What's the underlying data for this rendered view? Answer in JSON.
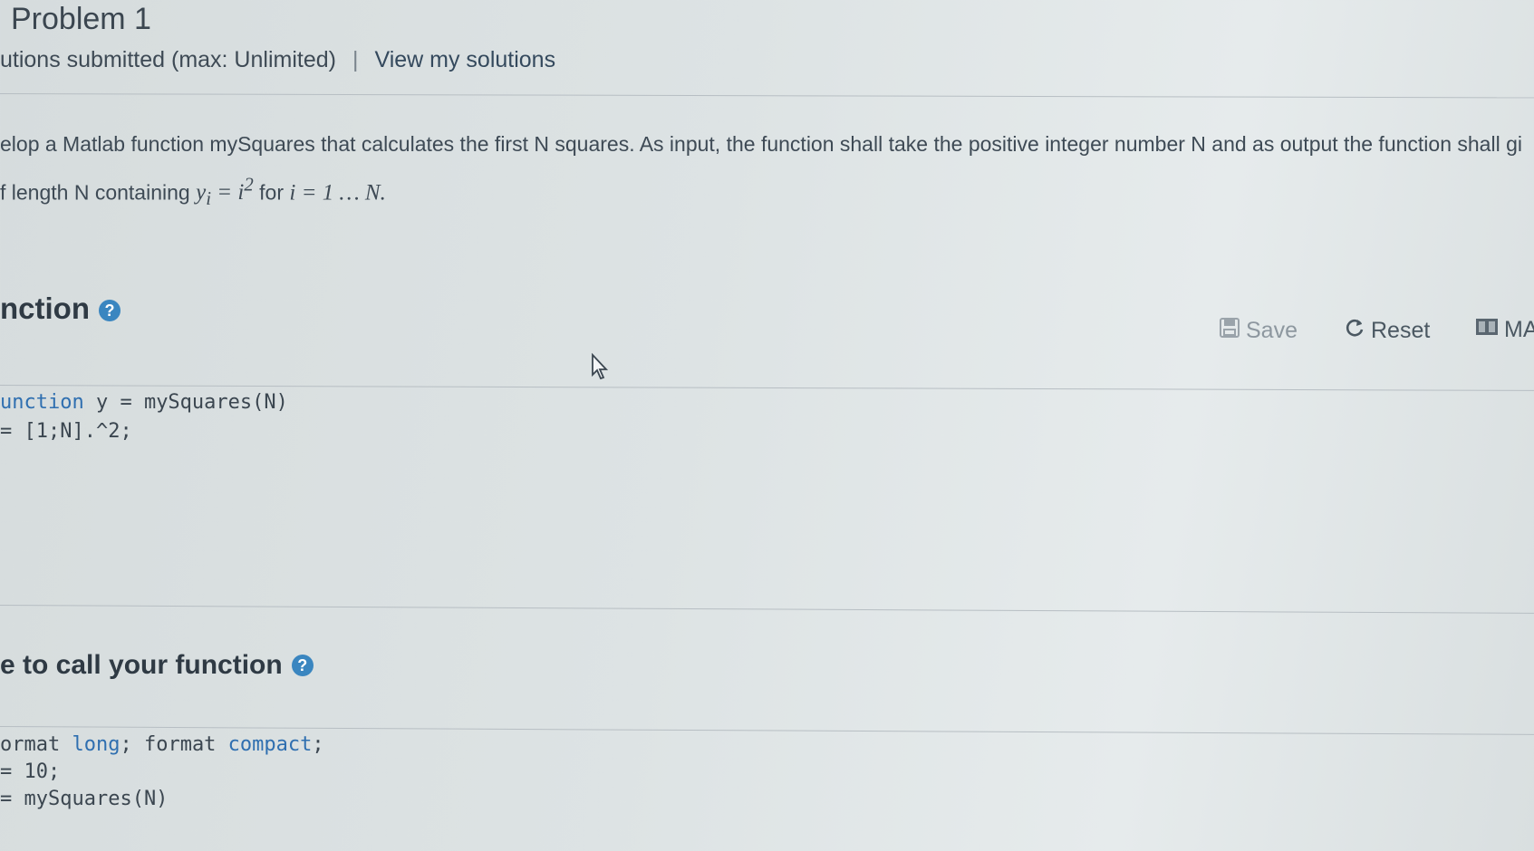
{
  "header": {
    "title": "Problem 1",
    "submissions_text": "utions submitted (max: Unlimited)",
    "separator": "|",
    "view_solutions_link": "View my solutions"
  },
  "description": {
    "line1": "elop a Matlab function mySquares that calculates the first N squares. As input, the function shall take the positive integer number N and as output the function shall gi",
    "line2_prefix": "f length N containing",
    "line2_formula": "y",
    "line2_sub": "i",
    "line2_eq": " = i",
    "line2_sup": "2",
    "line2_for": " for ",
    "line2_range": "i = 1 … N."
  },
  "function_section": {
    "heading": "nction",
    "help_glyph": "?",
    "toolbar": {
      "save_label": "Save",
      "reset_label": "Reset",
      "matlab_label": "MA"
    },
    "code": {
      "line1_keyword": "unction",
      "line1_rest": " y = mySquares(N)",
      "line2": " = [1;N].^2;"
    }
  },
  "call_section": {
    "heading": "e to call your function",
    "help_glyph": "?",
    "code": {
      "line1_a": "ormat",
      "line1_b": " long",
      "line1_c": "; format",
      "line1_d": " compact",
      "line1_e": ";",
      "line2": " = 10;",
      "line3": " = mySquares(N)"
    }
  },
  "colors": {
    "accent": "#3a86c0",
    "keyword": "#2f6fb0",
    "text": "#3d4a55"
  }
}
